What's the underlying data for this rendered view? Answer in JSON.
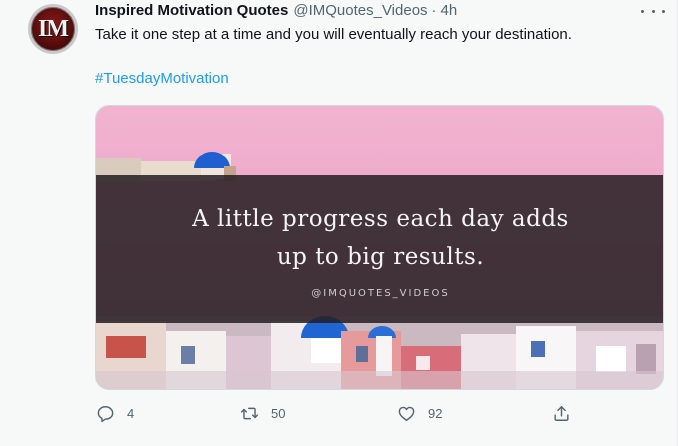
{
  "tweet": {
    "avatar_text": "IM",
    "author_name": "Inspired Motivation Quotes",
    "author_handle": "@IMQuotes_Videos",
    "separator": "·",
    "timestamp": "4h",
    "text": "Take it one step at a time and you will eventually reach your destination.",
    "hashtag": "#TuesdayMotivation",
    "media": {
      "quote_line_1": "A little progress each day adds",
      "quote_line_2": "up to big results.",
      "watermark": "@IMQUOTES_VIDEOS"
    },
    "actions": {
      "replies": "4",
      "retweets": "50",
      "likes": "92"
    }
  },
  "icons": [
    "more-icon",
    "reply-icon",
    "retweet-icon",
    "like-icon",
    "share-icon"
  ],
  "colors": {
    "link": "#1d9bf0",
    "secondary_text": "#536471",
    "background": "#f7f9f9"
  }
}
